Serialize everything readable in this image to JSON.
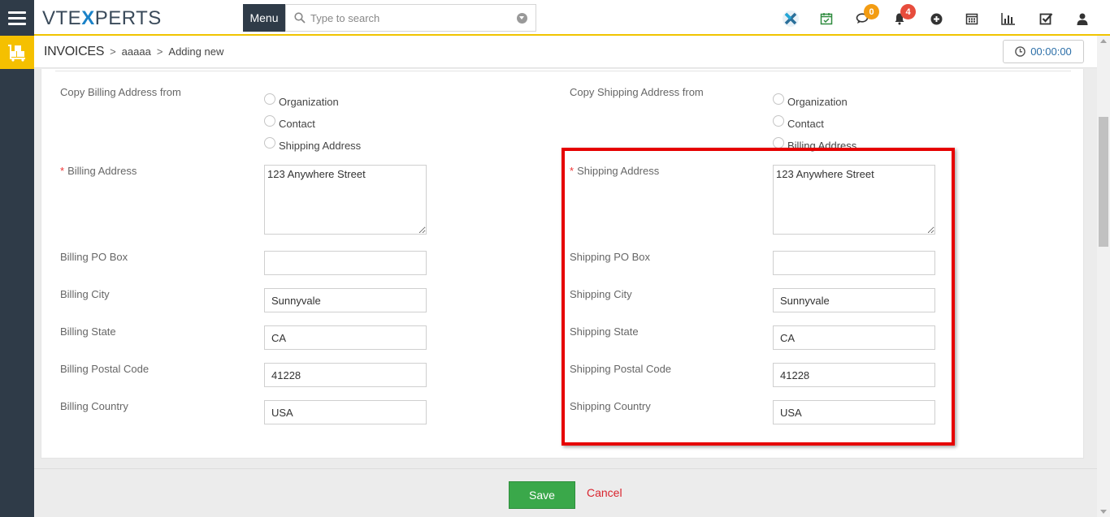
{
  "app": {
    "logo_pre": "VTE",
    "logo_x": "X",
    "logo_post": "PERTS"
  },
  "header": {
    "menu_label": "Menu",
    "search_placeholder": "Type to search",
    "chat_count": "0",
    "notification_count": "4",
    "colors": {
      "chat_badge": "#f39c12",
      "notification_badge": "#e74c3c"
    }
  },
  "breadcrumb": {
    "module": "INVOICES",
    "record": "aaaaa",
    "action": "Adding new"
  },
  "timer": {
    "value": "00:00:00"
  },
  "billing": {
    "copy_label": "Copy Billing Address from",
    "options": [
      "Organization",
      "Contact",
      "Shipping Address"
    ],
    "address_label": "Billing Address",
    "address_value": "123 Anywhere Street",
    "po_box_label": "Billing PO Box",
    "po_box_value": "",
    "city_label": "Billing City",
    "city_value": "Sunnyvale",
    "state_label": "Billing State",
    "state_value": "CA",
    "postal_label": "Billing Postal Code",
    "postal_value": "41228",
    "country_label": "Billing Country",
    "country_value": "USA"
  },
  "shipping": {
    "copy_label": "Copy Shipping Address from",
    "options": [
      "Organization",
      "Contact",
      "Billing Address"
    ],
    "address_label": "Shipping Address",
    "address_value": "123 Anywhere Street",
    "po_box_label": "Shipping PO Box",
    "po_box_value": "",
    "city_label": "Shipping City",
    "city_value": "Sunnyvale",
    "state_label": "Shipping State",
    "state_value": "CA",
    "postal_label": "Shipping Postal Code",
    "postal_value": "41228",
    "country_label": "Shipping Country",
    "country_value": "USA"
  },
  "required_marker": "*",
  "footer": {
    "save_label": "Save",
    "cancel_label": "Cancel"
  }
}
